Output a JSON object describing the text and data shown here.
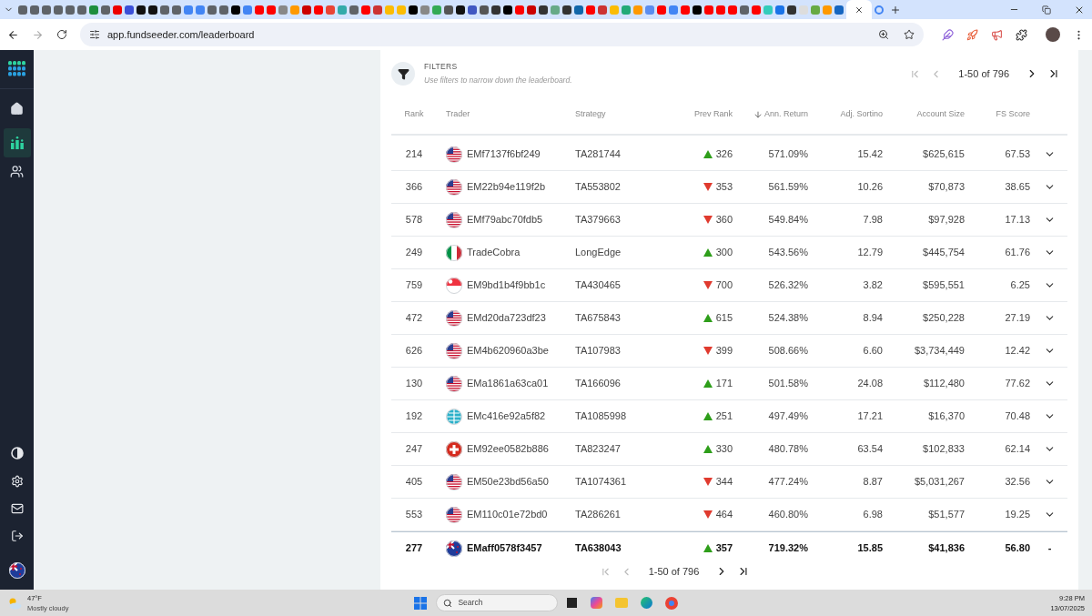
{
  "browser": {
    "url": "app.fundseeder.com/leaderboard"
  },
  "filters": {
    "title": "FILTERS",
    "hint": "Use filters to narrow down the leaderboard."
  },
  "pagination_top": {
    "range": "1-50 of 796"
  },
  "table": {
    "columns": [
      "Rank",
      "Trader",
      "Strategy",
      "Prev Rank",
      "Ann. Return",
      "Adj. Sortino",
      "Account Size",
      "FS Score"
    ],
    "rows": [
      {
        "rank": "214",
        "flag": {
          "kind": "us"
        },
        "trader": "EMf7137f6bf249",
        "strategy": "TA281744",
        "rank_up": true,
        "prev_rank": "326",
        "ann_return": "571.09%",
        "sortino": "15.42",
        "account_size": "$625,615",
        "fs_score": "67.53"
      },
      {
        "rank": "366",
        "flag": {
          "kind": "us"
        },
        "trader": "EM22b94e119f2b",
        "strategy": "TA553802",
        "rank_up": false,
        "prev_rank": "353",
        "ann_return": "561.59%",
        "sortino": "10.26",
        "account_size": "$70,873",
        "fs_score": "38.65"
      },
      {
        "rank": "578",
        "flag": {
          "kind": "us"
        },
        "trader": "EMf79abc70fdb5",
        "strategy": "TA379663",
        "rank_up": false,
        "prev_rank": "360",
        "ann_return": "549.84%",
        "sortino": "7.98",
        "account_size": "$97,928",
        "fs_score": "17.13"
      },
      {
        "rank": "249",
        "flag": {
          "kind": "it"
        },
        "trader": "TradeCobra",
        "strategy": "LongEdge",
        "rank_up": true,
        "prev_rank": "300",
        "ann_return": "543.56%",
        "sortino": "12.79",
        "account_size": "$445,754",
        "fs_score": "61.76"
      },
      {
        "rank": "759",
        "flag": {
          "kind": "sg"
        },
        "trader": "EM9bd1b4f9bb1c",
        "strategy": "TA430465",
        "rank_up": false,
        "prev_rank": "700",
        "ann_return": "526.32%",
        "sortino": "3.82",
        "account_size": "$595,551",
        "fs_score": "6.25"
      },
      {
        "rank": "472",
        "flag": {
          "kind": "us"
        },
        "trader": "EMd20da723df23",
        "strategy": "TA675843",
        "rank_up": true,
        "prev_rank": "615",
        "ann_return": "524.38%",
        "sortino": "8.94",
        "account_size": "$250,228",
        "fs_score": "27.19"
      },
      {
        "rank": "626",
        "flag": {
          "kind": "us"
        },
        "trader": "EM4b620960a3be",
        "strategy": "TA107983",
        "rank_up": false,
        "prev_rank": "399",
        "ann_return": "508.66%",
        "sortino": "6.60",
        "account_size": "$3,734,449",
        "fs_score": "12.42"
      },
      {
        "rank": "130",
        "flag": {
          "kind": "us"
        },
        "trader": "EMa1861a63ca01",
        "strategy": "TA166096",
        "rank_up": true,
        "prev_rank": "171",
        "ann_return": "501.58%",
        "sortino": "24.08",
        "account_size": "$112,480",
        "fs_score": "77.62"
      },
      {
        "rank": "192",
        "flag": {
          "kind": "globe"
        },
        "trader": "EMc416e92a5f82",
        "strategy": "TA1085998",
        "rank_up": true,
        "prev_rank": "251",
        "ann_return": "497.49%",
        "sortino": "17.21",
        "account_size": "$16,370",
        "fs_score": "70.48"
      },
      {
        "rank": "247",
        "flag": {
          "kind": "ch"
        },
        "trader": "EM92ee0582b886",
        "strategy": "TA823247",
        "rank_up": true,
        "prev_rank": "330",
        "ann_return": "480.78%",
        "sortino": "63.54",
        "account_size": "$102,833",
        "fs_score": "62.14"
      },
      {
        "rank": "405",
        "flag": {
          "kind": "us"
        },
        "trader": "EM50e23bd56a50",
        "strategy": "TA1074361",
        "rank_up": false,
        "prev_rank": "344",
        "ann_return": "477.24%",
        "sortino": "8.87",
        "account_size": "$5,031,267",
        "fs_score": "32.56"
      },
      {
        "rank": "553",
        "flag": {
          "kind": "us"
        },
        "trader": "EM110c01e72bd0",
        "strategy": "TA286261",
        "rank_up": false,
        "prev_rank": "464",
        "ann_return": "460.80%",
        "sortino": "6.98",
        "account_size": "$51,577",
        "fs_score": "19.25"
      }
    ],
    "own_row": {
      "rank": "277",
      "flag": {
        "kind": "nz"
      },
      "trader": "EMaff0578f3457",
      "strategy": "TA638043",
      "rank_up": true,
      "prev_rank": "357",
      "ann_return": "719.32%",
      "sortino": "15.85",
      "account_size": "$41,836",
      "fs_score": "56.80",
      "action": "-"
    }
  },
  "sidebar": {
    "user_flag": {
      "kind": "nz"
    }
  },
  "pagination_bottom": {
    "range": "1-50 of 796"
  },
  "taskbar": {
    "temperature": "47°F",
    "weather": "Mostly cloudy",
    "search_placeholder": "Search",
    "time": "9:28 PM",
    "date": "13/07/2025"
  }
}
